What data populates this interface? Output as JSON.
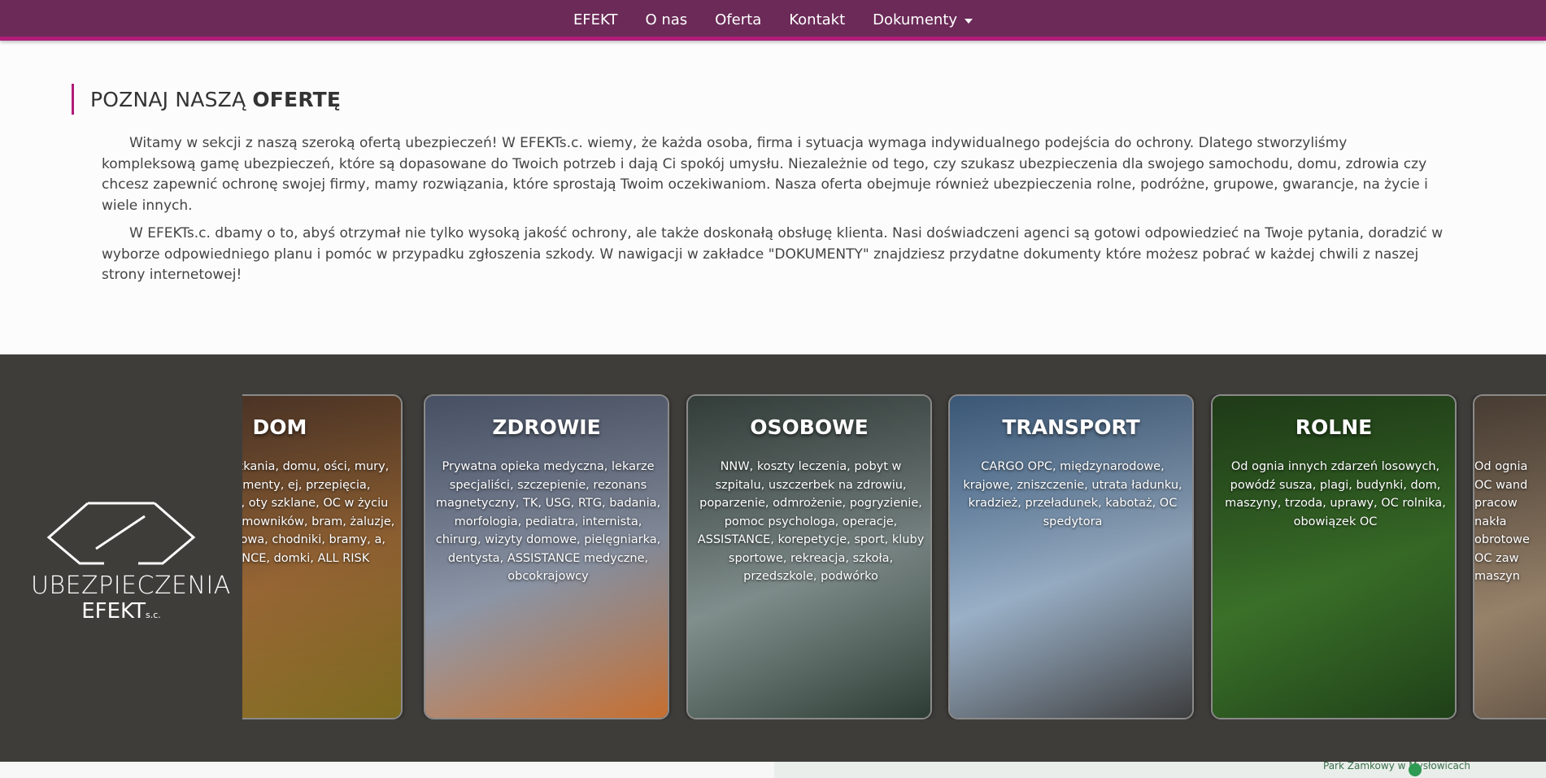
{
  "nav": {
    "items": [
      "EFEKT",
      "O nas",
      "Oferta",
      "Kontakt"
    ],
    "dropdown": "Dokumenty"
  },
  "offer": {
    "heading_light": "POZNAJ NASZĄ",
    "heading_bold": "OFERTĘ",
    "paragraph1": "Witamy w sekcji z naszą szeroką ofertą ubezpieczeń! W EFEKTs.c. wiemy, że każda osoba, firma i sytuacja wymaga indywidualnego podejścia do ochrony. Dlatego stworzyliśmy kompleksową gamę ubezpieczeń, które są dopasowane do Twoich potrzeb i dają Ci spokój umysłu. Niezależnie od tego, czy szukasz ubezpieczenia dla swojego samochodu, domu, zdrowia czy chcesz zapewnić ochronę swojej firmy, mamy rozwiązania, które sprostają Twoim oczekiwaniom. Nasza oferta obejmuje również ubezpieczenia rolne, podróżne, grupowe, gwarancje, na życie i wiele innych.",
    "paragraph2": "W EFEKTs.c. dbamy o to, abyś otrzymał nie tylko wysoką jakość ochrony, ale także doskonałą obsługę klienta. Nasi doświadczeni agenci są gotowi odpowiedzieć na Twoje pytania, doradzić w wyborze odpowiedniego planu i pomóc w przypadku zgłoszenia szkody. W nawigacji w zakładce \"DOKUMENTY\" znajdziesz przydatne dokumenty które możesz pobrać w każdej chwili z naszej strony internetowej!"
  },
  "logo": {
    "line1": "UBEZPIECZENIA",
    "line2": "EFEKT",
    "suffix": "s.c."
  },
  "cards": [
    {
      "title": "DOM",
      "desc": "zenie mieszkania, domu, ości, mury, stałe elementy, ej, przepięcia, dewastacja, oty szklane, OC w życiu ym, NNW domowników, bram, żaluzje, roślinność owa, chodniki, bramy, a, ASSISTANCE, domki, ALL RISK",
      "colors": [
        "#6b4a3a",
        "#a8713a",
        "#7b6a1f"
      ]
    },
    {
      "title": "ZDROWIE",
      "desc": "Prywatna opieka medyczna, lekarze specjaliści, szczepienie, rezonans magnetyczny, TK, USG, RTG, badania, morfologia, pediatra, internista, chirurg, wizyty domowe, pielęgniarka, dentysta, ASSISTANCE medyczne, obcokrajowcy",
      "colors": [
        "#6d7b99",
        "#9aa4b6",
        "#c66e2f"
      ]
    },
    {
      "title": "OSOBOWE",
      "desc": "NNW, koszty leczenia, pobyt w szpitalu, uszczerbek na zdrowiu, poparzenie, odmrożenie, pogryzienie, pomoc psychologa, operacje, ASSISTANCE, korepetycje, sport, kluby sportowe, rekreacja, szkoła, przedszkole, podwórko",
      "colors": [
        "#4e5d58",
        "#8b9a98",
        "#2c3b33"
      ]
    },
    {
      "title": "TRANSPORT",
      "desc": "CARGO OPC, międzynarodowe, krajowe, zniszczenie, utrata ładunku, kradzież, przeładunek, kabotaż, OC spedytora",
      "colors": [
        "#5a86b6",
        "#a7bfd8",
        "#3c3c3c"
      ]
    },
    {
      "title": "ROLNE",
      "desc": "Od ognia innych zdarzeń losowych, powódź susza, plagi, budynki, dom, maszyny, trzoda, uprawy, OC rolnika, obowiązek OC",
      "colors": [
        "#2f5a24",
        "#3f7a2c",
        "#1f3f18"
      ]
    },
    {
      "title": "",
      "desc": "Od ognia OC wand pracow nakła obrotowe OC zaw maszyn",
      "colors": [
        "#6e5d4e",
        "#a38c72",
        "#4c3f35"
      ]
    }
  ],
  "map": {
    "label": "Park Zamkowy w Mysłowicach"
  }
}
